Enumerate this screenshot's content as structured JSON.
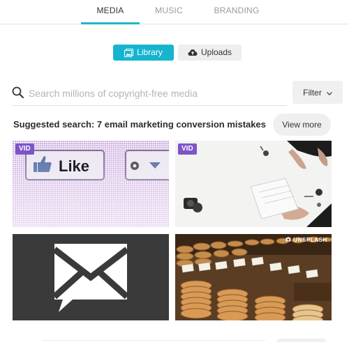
{
  "tabs": [
    {
      "label": "MEDIA",
      "active": true
    },
    {
      "label": "MUSIC",
      "active": false
    },
    {
      "label": "BRANDING",
      "active": false
    }
  ],
  "source_toggle": {
    "library_label": "Library",
    "uploads_label": "Uploads",
    "selected": "Library"
  },
  "search": {
    "value": "",
    "placeholder": "Search millions of copyright-free media",
    "icon": "search-icon"
  },
  "filter": {
    "label": "Filter",
    "icon": "chevron-down-icon"
  },
  "suggested": {
    "text": "Suggested search: 7 email marketing conversion mistakes",
    "view_more_label": "View more"
  },
  "results": [
    {
      "badge": "VID",
      "subject": "facebook like button",
      "like_text": "Like"
    },
    {
      "badge": "VID",
      "subject": "hands at desk with notebook"
    },
    {
      "badge": "",
      "subject": "envelope mail icon"
    },
    {
      "badge": "",
      "subject": "cookies in bakery display",
      "source": "UNSPLASH"
    }
  ],
  "colors": {
    "accent": "#17b4cf",
    "vid_badge": "#7d55c7",
    "tab_inactive": "#9a9a9a"
  }
}
